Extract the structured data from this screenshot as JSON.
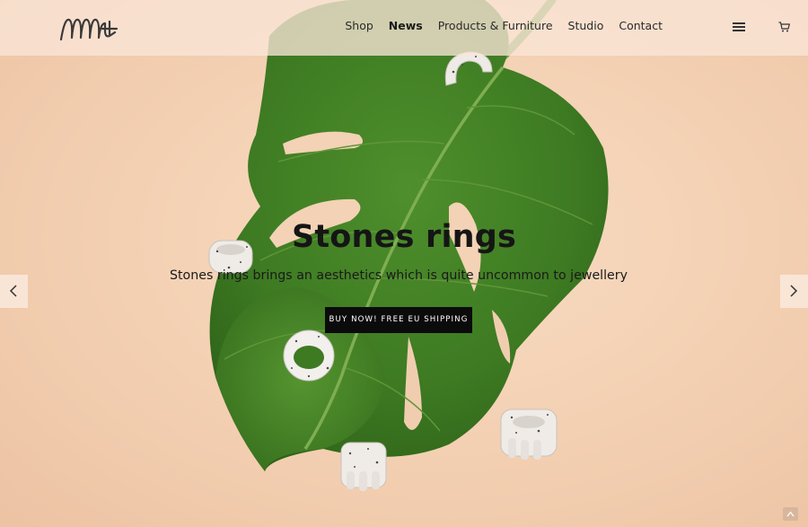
{
  "nav": {
    "items": [
      {
        "label": "Shop",
        "active": false
      },
      {
        "label": "News",
        "active": true
      },
      {
        "label": "Products & Furniture",
        "active": false
      },
      {
        "label": "Studio",
        "active": false
      },
      {
        "label": "Contact",
        "active": false
      }
    ],
    "menu_icon": "hamburger-icon",
    "cart_icon": "cart-icon"
  },
  "hero": {
    "title": "Stones rings",
    "subtitle": "Stones rings brings an aesthetics which is quite uncommon to jewellery",
    "cta_label": "BUY NOW! FREE EU SHIPPING",
    "prev_icon": "chevron-left-icon",
    "next_icon": "chevron-right-icon"
  },
  "colors": {
    "background": "#f4d2b6",
    "leaf": "#3f7b22",
    "button": "#0b0b0b"
  },
  "back_to_top_icon": "arrow-up-icon"
}
